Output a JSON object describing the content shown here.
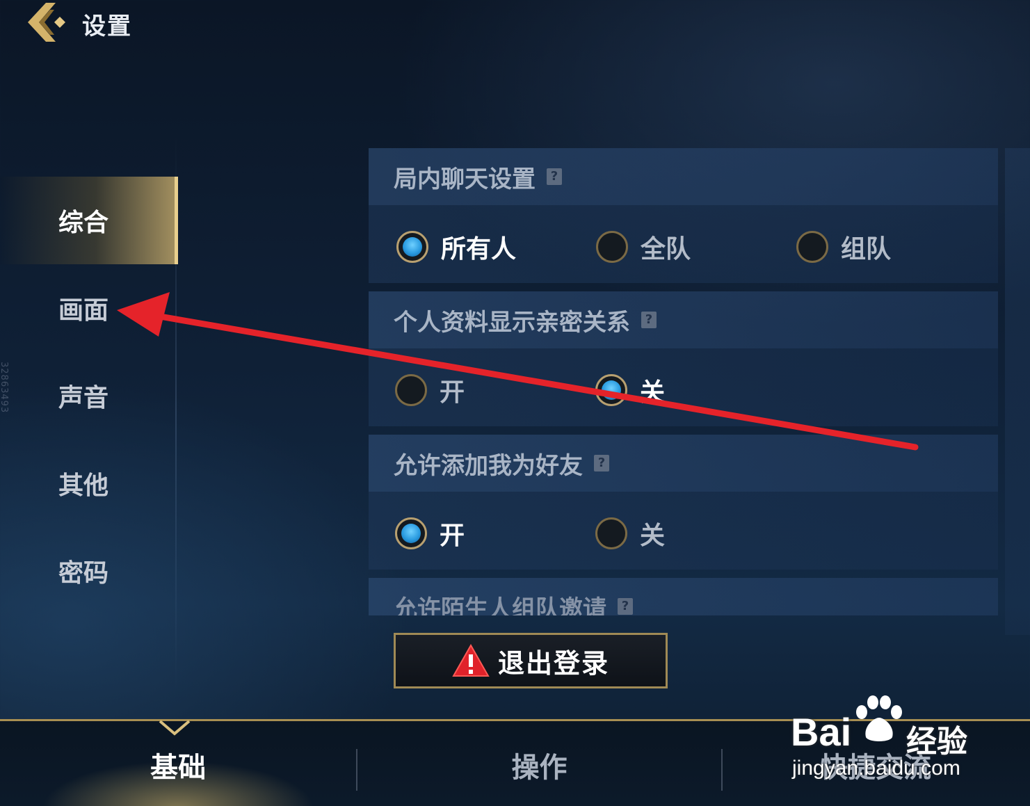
{
  "header": {
    "title": "设置"
  },
  "side_nav": {
    "items": [
      {
        "label": "综合",
        "active": true
      },
      {
        "label": "画面",
        "active": false
      },
      {
        "label": "声音",
        "active": false
      },
      {
        "label": "其他",
        "active": false
      },
      {
        "label": "密码",
        "active": false
      }
    ],
    "vertical_text": "32863493"
  },
  "sections": [
    {
      "title": "局内聊天设置",
      "options": [
        "所有人",
        "全队",
        "组队"
      ],
      "selected": "所有人"
    },
    {
      "title": "个人资料显示亲密关系",
      "options": [
        "开",
        "关"
      ],
      "selected": "关"
    },
    {
      "title": "允许添加我为好友",
      "options": [
        "开",
        "关"
      ],
      "selected": "开"
    },
    {
      "title": "允许陌生人组队邀请"
    }
  ],
  "help_glyph": "?",
  "logout": {
    "label": "退出登录",
    "icon": "warning-icon",
    "icon_color": "#e0222a"
  },
  "tabs": [
    {
      "label": "基础",
      "active": true
    },
    {
      "label": "操作",
      "active": false
    },
    {
      "label": "快捷交流",
      "active": false
    }
  ],
  "watermark": {
    "brand": "Bai",
    "cn": "经验",
    "url": "jingyan.baidu.com"
  },
  "colors": {
    "accent_gold": "#e8cf8e",
    "radio_selected": "#2a9be0",
    "annotation_arrow": "#e5232a"
  }
}
